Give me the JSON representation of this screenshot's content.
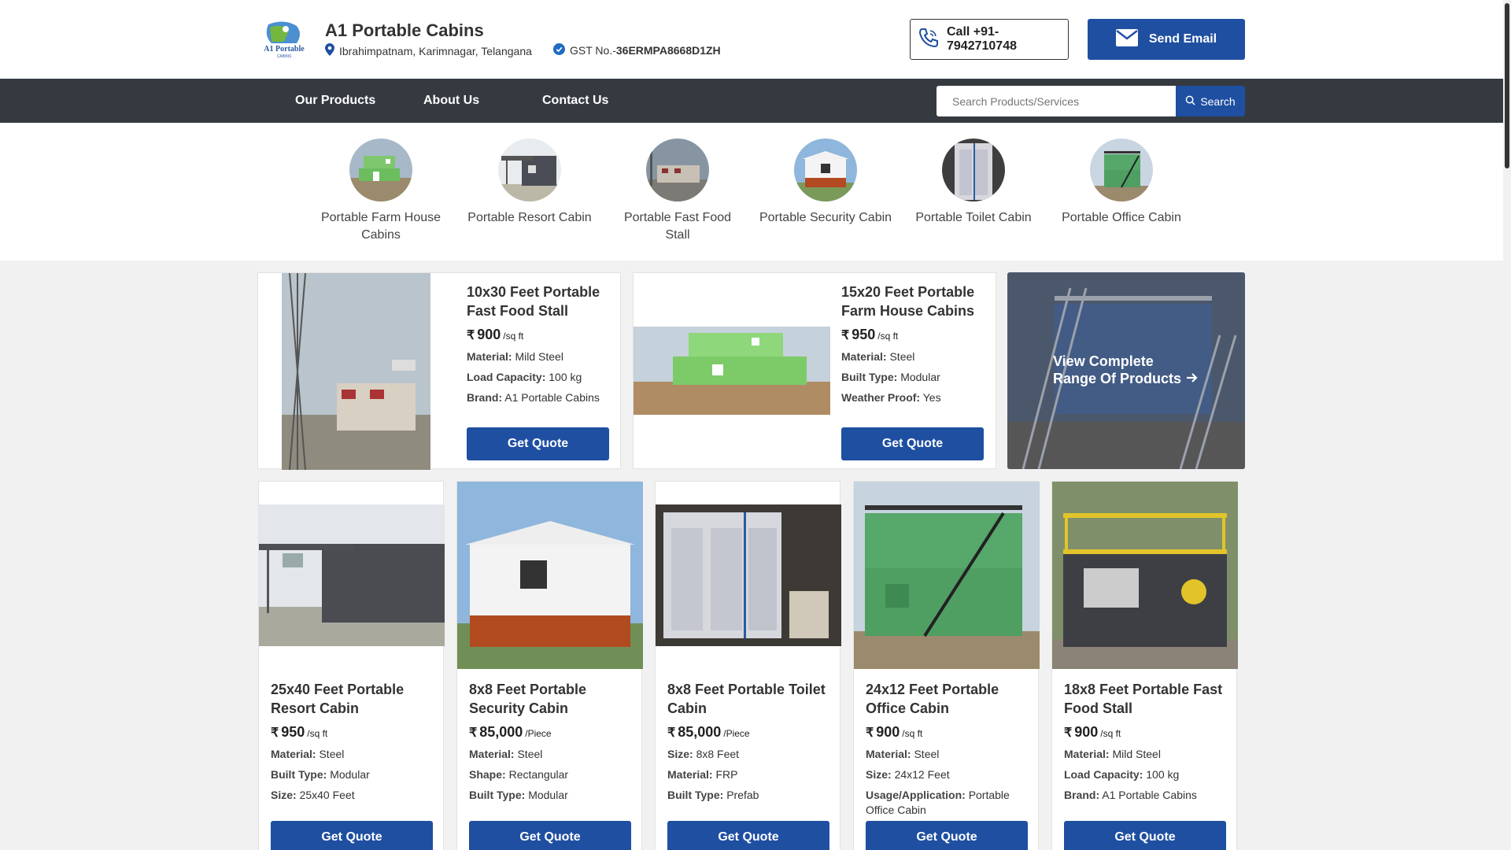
{
  "company": {
    "name": "A1 Portable Cabins",
    "location": "Ibrahimpatnam, Karimnagar, Telangana",
    "gst_label": "GST No.-",
    "gst_number": "36ERMPA8668D1ZH",
    "logo_text": "A1 Portable",
    "logo_subtext": "CABINS"
  },
  "header": {
    "call_label": "Call +91-7942710748",
    "email_label": "Send Email"
  },
  "nav": {
    "items": [
      "Our Products",
      "About Us",
      "Contact Us"
    ],
    "search_placeholder": "Search Products/Services",
    "search_label": "Search"
  },
  "categories": [
    {
      "label": "Portable Farm House Cabins"
    },
    {
      "label": "Portable Resort Cabin"
    },
    {
      "label": "Portable Fast Food Stall"
    },
    {
      "label": "Portable Security Cabin"
    },
    {
      "label": "Portable Toilet Cabin"
    },
    {
      "label": "Portable Office Cabin"
    }
  ],
  "featured": [
    {
      "title": "10x30 Feet Portable Fast Food Stall",
      "price": "900",
      "unit": "/sq ft",
      "specs": [
        {
          "k": "Material:",
          "v": "Mild Steel"
        },
        {
          "k": "Load Capacity:",
          "v": "100 kg"
        },
        {
          "k": "Brand:",
          "v": "A1 Portable Cabins"
        }
      ],
      "cta": "Get Quote"
    },
    {
      "title": "15x20 Feet Portable Farm House Cabins",
      "price": "950",
      "unit": "/sq ft",
      "specs": [
        {
          "k": "Material:",
          "v": "Steel"
        },
        {
          "k": "Built Type:",
          "v": "Modular"
        },
        {
          "k": "Weather Proof:",
          "v": "Yes"
        }
      ],
      "cta": "Get Quote"
    }
  ],
  "view_all": {
    "line1": "View Complete",
    "line2": "Range Of Products"
  },
  "products": [
    {
      "title": "25x40 Feet Portable Resort Cabin",
      "price": "950",
      "unit": "/sq ft",
      "specs": [
        {
          "k": "Material:",
          "v": "Steel"
        },
        {
          "k": "Built Type:",
          "v": "Modular"
        },
        {
          "k": "Size:",
          "v": "25x40 Feet"
        }
      ],
      "cta": "Get Quote"
    },
    {
      "title": "8x8 Feet Portable Security Cabin",
      "price": "85,000",
      "unit": "/Piece",
      "specs": [
        {
          "k": "Material:",
          "v": "Steel"
        },
        {
          "k": "Shape:",
          "v": "Rectangular"
        },
        {
          "k": "Built Type:",
          "v": "Modular"
        }
      ],
      "cta": "Get Quote"
    },
    {
      "title": "8x8 Feet Portable Toilet Cabin",
      "price": "85,000",
      "unit": "/Piece",
      "specs": [
        {
          "k": "Size:",
          "v": "8x8 Feet"
        },
        {
          "k": "Material:",
          "v": "FRP"
        },
        {
          "k": "Built Type:",
          "v": "Prefab"
        }
      ],
      "cta": "Get Quote"
    },
    {
      "title": "24x12 Feet Portable Office Cabin",
      "price": "900",
      "unit": "/sq ft",
      "specs": [
        {
          "k": "Material:",
          "v": "Steel"
        },
        {
          "k": "Size:",
          "v": "24x12 Feet"
        },
        {
          "k": "Usage/Application:",
          "v": "Portable Office Cabin"
        }
      ],
      "cta": "Get Quote"
    },
    {
      "title": "18x8 Feet Portable Fast Food Stall",
      "price": "900",
      "unit": "/sq ft",
      "specs": [
        {
          "k": "Material:",
          "v": "Mild Steel"
        },
        {
          "k": "Load Capacity:",
          "v": "100 kg"
        },
        {
          "k": "Brand:",
          "v": "A1 Portable Cabins"
        }
      ],
      "cta": "Get Quote"
    }
  ],
  "colors": {
    "primary": "#1f4fa1",
    "nav": "#343a40"
  },
  "rupee_symbol": "₹"
}
